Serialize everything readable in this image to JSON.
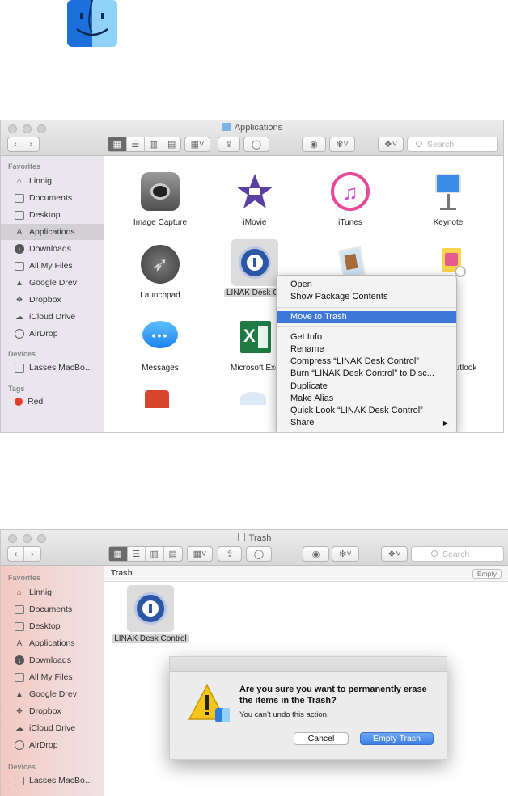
{
  "window1": {
    "title": "Applications",
    "search_placeholder": "Search",
    "sidebar": {
      "favorites_heading": "Favorites",
      "items": [
        {
          "label": "Linnig",
          "icon": "house-icon"
        },
        {
          "label": "Documents",
          "icon": "documents-icon"
        },
        {
          "label": "Desktop",
          "icon": "desktop-icon"
        },
        {
          "label": "Applications",
          "icon": "applications-icon",
          "selected": true
        },
        {
          "label": "Downloads",
          "icon": "downloads-icon"
        },
        {
          "label": "All My Files",
          "icon": "all-files-icon"
        },
        {
          "label": "Google Drev",
          "icon": "google-drive-icon"
        },
        {
          "label": "Dropbox",
          "icon": "dropbox-icon"
        },
        {
          "label": "iCloud Drive",
          "icon": "icloud-icon"
        },
        {
          "label": "AirDrop",
          "icon": "airdrop-icon"
        }
      ],
      "devices_heading": "Devices",
      "devices": [
        {
          "label": "Lasses MacBo...",
          "icon": "laptop-icon"
        }
      ],
      "tags_heading": "Tags",
      "tags": [
        {
          "label": "Red",
          "color": "#e43d30"
        }
      ]
    },
    "apps": [
      {
        "label": "Image Capture",
        "icon": "image-capture-icon"
      },
      {
        "label": "iMovie",
        "icon": "imovie-icon"
      },
      {
        "label": "iTunes",
        "icon": "itunes-icon"
      },
      {
        "label": "Keynote",
        "icon": "keynote-icon"
      },
      {
        "label": "Launchpad",
        "icon": "launchpad-icon"
      },
      {
        "label": "LINAK Desk Co",
        "icon": "linak-icon"
      },
      {
        "label": "",
        "icon": "preview-icon"
      },
      {
        "label": "",
        "icon": "photos-icon"
      },
      {
        "label": "Messages",
        "icon": "messages-icon"
      },
      {
        "label": "Microsoft Exc",
        "icon": "excel-icon"
      },
      {
        "label": "utlook",
        "icon": "outlook-icon"
      }
    ],
    "context_menu": {
      "items": [
        {
          "label": "Open"
        },
        {
          "label": "Show Package Contents"
        },
        {
          "label": "Move to Trash",
          "selected": true
        },
        {
          "label": "Get Info"
        },
        {
          "label": "Rename"
        },
        {
          "label": "Compress “LINAK Desk Control”"
        },
        {
          "label": "Burn “LINAK Desk Control” to Disc..."
        },
        {
          "label": "Duplicate"
        },
        {
          "label": "Make Alias"
        },
        {
          "label": "Quick Look “LINAK Desk Control”"
        },
        {
          "label": "Share",
          "submenu": true
        }
      ],
      "submenu_arrow": "▶"
    }
  },
  "window2": {
    "title": "Trash",
    "search_placeholder": "Search",
    "path_title": "Trash",
    "empty_button": "Empty",
    "sidebar": {
      "favorites_heading": "Favorites",
      "items": [
        {
          "label": "Linnig"
        },
        {
          "label": "Documents"
        },
        {
          "label": "Desktop"
        },
        {
          "label": "Applications"
        },
        {
          "label": "Downloads"
        },
        {
          "label": "All My Files"
        },
        {
          "label": "Google Drev"
        },
        {
          "label": "Dropbox"
        },
        {
          "label": "iCloud Drive"
        },
        {
          "label": "AirDrop"
        }
      ],
      "devices_heading": "Devices",
      "devices": [
        {
          "label": "Lasses MacBo..."
        }
      ]
    },
    "trash_item": {
      "label": "LINAK Desk Control"
    },
    "dialog": {
      "message": "Are you sure you want to permanently erase the items in the Trash?",
      "sub": "You can’t undo this action.",
      "cancel": "Cancel",
      "confirm": "Empty Trash"
    }
  },
  "colors": {
    "accent": "#3d78d8",
    "red_tag": "#e43d30"
  }
}
